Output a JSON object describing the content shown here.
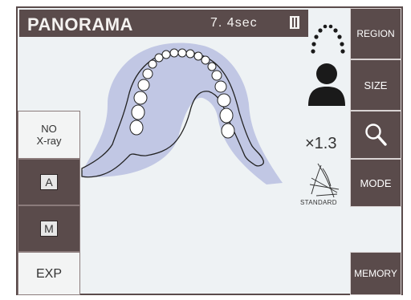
{
  "header": {
    "title": "PANORAMA",
    "exposure_time": "7. 4sec"
  },
  "left_panel": {
    "no_xray_line1": "NO",
    "no_xray_line2": "X-ray",
    "auto_key": "A",
    "manual_key": "M",
    "exp_label": "EXP"
  },
  "right_panel": {
    "region_label": "REGION",
    "size_label": "SIZE",
    "mode_label": "MODE",
    "memory_label": "MEMORY"
  },
  "status": {
    "magnification": "×1.3",
    "mode_name": "STANDARD"
  },
  "icons": {
    "region": "arch-icon",
    "size": "patient-silhouette-icon",
    "zoom": "magnifier-icon",
    "mode": "standard-mode-icon",
    "cassette": "cassette-icon",
    "main_view": "dental-arch-jaw-diagram"
  },
  "colors": {
    "button": "#5a4b4b",
    "panel": "#eef2f4",
    "jaw_shadow": "#b8c0e0",
    "light_button": "#f3f4f4"
  }
}
